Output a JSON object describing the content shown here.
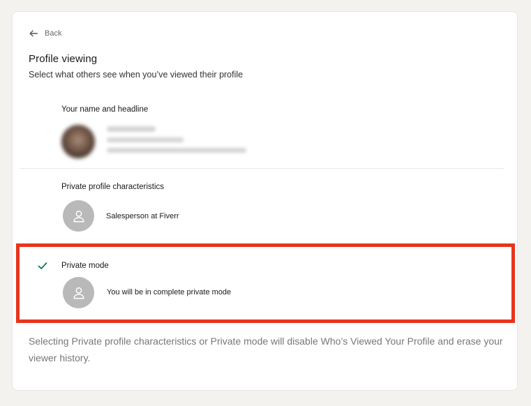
{
  "nav": {
    "back_label": "Back"
  },
  "header": {
    "title": "Profile viewing",
    "subtitle": "Select what others see when you’ve viewed their profile"
  },
  "options": [
    {
      "label": "Your name and headline",
      "description": "",
      "selected": false
    },
    {
      "label": "Private profile characteristics",
      "description": "Salesperson at Fiverr",
      "selected": false
    },
    {
      "label": "Private mode",
      "description": "You will be in complete private mode",
      "selected": true
    }
  ],
  "footer": {
    "note": "Selecting Private profile characteristics or Private mode will disable Who’s Viewed Your Profile and erase your viewer history."
  },
  "icons": {
    "back": "arrow-left-icon",
    "check": "checkmark-icon",
    "avatar": "person-silhouette-icon"
  },
  "colors": {
    "highlight": "#e8341c",
    "check": "#057642",
    "avatar_bg": "#b9b9b9"
  }
}
